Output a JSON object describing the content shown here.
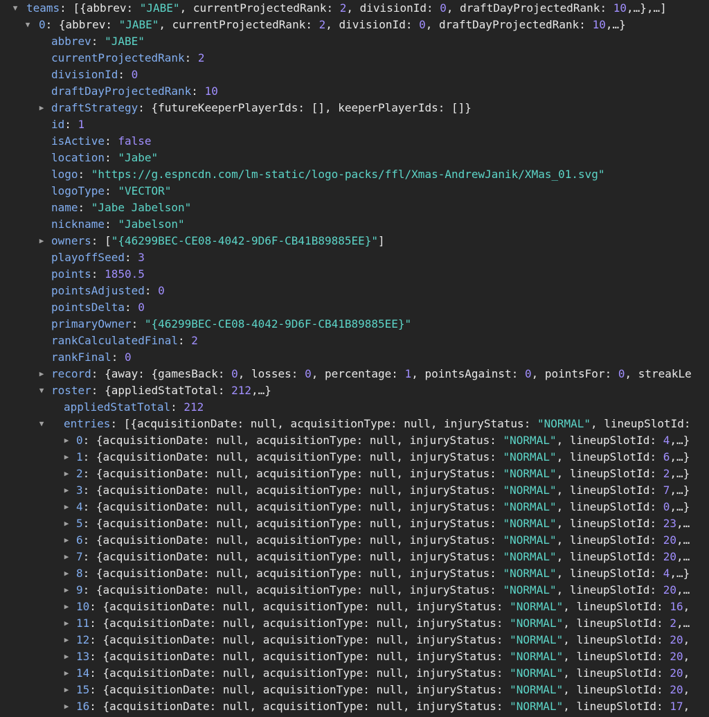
{
  "colors": {
    "background": "#242424",
    "key": "#82aef0",
    "string": "#5cd5c8",
    "number": "#a18fff",
    "text": "#e8e8e8",
    "toggle": "#a0a0a0"
  },
  "icons": {
    "expanded": "triangle-down-icon",
    "collapsed": "triangle-right-icon"
  },
  "rows": [
    {
      "depth": 0,
      "toggle": "expanded",
      "key": "teams",
      "summary": "[{abbrev: \"JABE\", currentProjectedRank: 2, divisionId: 0, draftDayProjectedRank: 10,…},…]"
    },
    {
      "depth": 1,
      "toggle": "expanded",
      "key": "0",
      "summary": "{abbrev: \"JABE\", currentProjectedRank: 2, divisionId: 0, draftDayProjectedRank: 10,…}"
    },
    {
      "depth": 2,
      "key": "abbrev",
      "value": "\"JABE\"",
      "type": "string"
    },
    {
      "depth": 2,
      "key": "currentProjectedRank",
      "value": "2",
      "type": "number"
    },
    {
      "depth": 2,
      "key": "divisionId",
      "value": "0",
      "type": "number"
    },
    {
      "depth": 2,
      "key": "draftDayProjectedRank",
      "value": "10",
      "type": "number"
    },
    {
      "depth": 2,
      "toggle": "collapsed",
      "key": "draftStrategy",
      "summary": "{futureKeeperPlayerIds: [], keeperPlayerIds: []}"
    },
    {
      "depth": 2,
      "key": "id",
      "value": "1",
      "type": "number"
    },
    {
      "depth": 2,
      "key": "isActive",
      "value": "false",
      "type": "keyword"
    },
    {
      "depth": 2,
      "key": "location",
      "value": "\"Jabe\"",
      "type": "string"
    },
    {
      "depth": 2,
      "key": "logo",
      "value": "\"https://g.espncdn.com/lm-static/logo-packs/ffl/Xmas-AndrewJanik/XMas_01.svg\"",
      "type": "string"
    },
    {
      "depth": 2,
      "key": "logoType",
      "value": "\"VECTOR\"",
      "type": "string"
    },
    {
      "depth": 2,
      "key": "name",
      "value": "\"Jabe Jabelson\"",
      "type": "string"
    },
    {
      "depth": 2,
      "key": "nickname",
      "value": "\"Jabelson\"",
      "type": "string"
    },
    {
      "depth": 2,
      "toggle": "collapsed",
      "key": "owners",
      "summary": "[\"{46299BEC-CE08-4042-9D6F-CB41B89885EE}\"]"
    },
    {
      "depth": 2,
      "key": "playoffSeed",
      "value": "3",
      "type": "number"
    },
    {
      "depth": 2,
      "key": "points",
      "value": "1850.5",
      "type": "number"
    },
    {
      "depth": 2,
      "key": "pointsAdjusted",
      "value": "0",
      "type": "number"
    },
    {
      "depth": 2,
      "key": "pointsDelta",
      "value": "0",
      "type": "number"
    },
    {
      "depth": 2,
      "key": "primaryOwner",
      "value": "\"{46299BEC-CE08-4042-9D6F-CB41B89885EE}\"",
      "type": "string"
    },
    {
      "depth": 2,
      "key": "rankCalculatedFinal",
      "value": "2",
      "type": "number"
    },
    {
      "depth": 2,
      "key": "rankFinal",
      "value": "0",
      "type": "number"
    },
    {
      "depth": 2,
      "toggle": "collapsed",
      "key": "record",
      "summary": "{away: {gamesBack: 0, losses: 0, percentage: 1, pointsAgainst: 0, pointsFor: 0, streakLe"
    },
    {
      "depth": 2,
      "toggle": "expanded",
      "key": "roster",
      "summary": "{appliedStatTotal: 212,…}"
    },
    {
      "depth": 3,
      "key": "appliedStatTotal",
      "value": "212",
      "type": "number"
    },
    {
      "depth": 3,
      "toggle": "expanded",
      "key": "entries",
      "summary": "[{acquisitionDate: null, acquisitionType: null, injuryStatus: \"NORMAL\", lineupSlotId:"
    },
    {
      "depth": 4,
      "toggle": "collapsed",
      "key": "0",
      "summary": "{acquisitionDate: null, acquisitionType: null, injuryStatus: \"NORMAL\", lineupSlotId: 4,…}"
    },
    {
      "depth": 4,
      "toggle": "collapsed",
      "key": "1",
      "summary": "{acquisitionDate: null, acquisitionType: null, injuryStatus: \"NORMAL\", lineupSlotId: 6,…}"
    },
    {
      "depth": 4,
      "toggle": "collapsed",
      "key": "2",
      "summary": "{acquisitionDate: null, acquisitionType: null, injuryStatus: \"NORMAL\", lineupSlotId: 2,…}"
    },
    {
      "depth": 4,
      "toggle": "collapsed",
      "key": "3",
      "summary": "{acquisitionDate: null, acquisitionType: null, injuryStatus: \"NORMAL\", lineupSlotId: 7,…}"
    },
    {
      "depth": 4,
      "toggle": "collapsed",
      "key": "4",
      "summary": "{acquisitionDate: null, acquisitionType: null, injuryStatus: \"NORMAL\", lineupSlotId: 0,…}"
    },
    {
      "depth": 4,
      "toggle": "collapsed",
      "key": "5",
      "summary": "{acquisitionDate: null, acquisitionType: null, injuryStatus: \"NORMAL\", lineupSlotId: 23,…"
    },
    {
      "depth": 4,
      "toggle": "collapsed",
      "key": "6",
      "summary": "{acquisitionDate: null, acquisitionType: null, injuryStatus: \"NORMAL\", lineupSlotId: 20,…"
    },
    {
      "depth": 4,
      "toggle": "collapsed",
      "key": "7",
      "summary": "{acquisitionDate: null, acquisitionType: null, injuryStatus: \"NORMAL\", lineupSlotId: 20,…"
    },
    {
      "depth": 4,
      "toggle": "collapsed",
      "key": "8",
      "summary": "{acquisitionDate: null, acquisitionType: null, injuryStatus: \"NORMAL\", lineupSlotId: 4,…}"
    },
    {
      "depth": 4,
      "toggle": "collapsed",
      "key": "9",
      "summary": "{acquisitionDate: null, acquisitionType: null, injuryStatus: \"NORMAL\", lineupSlotId: 20,…"
    },
    {
      "depth": 4,
      "toggle": "collapsed",
      "key": "10",
      "summary": "{acquisitionDate: null, acquisitionType: null, injuryStatus: \"NORMAL\", lineupSlotId: 16,"
    },
    {
      "depth": 4,
      "toggle": "collapsed",
      "key": "11",
      "summary": "{acquisitionDate: null, acquisitionType: null, injuryStatus: \"NORMAL\", lineupSlotId: 2,…"
    },
    {
      "depth": 4,
      "toggle": "collapsed",
      "key": "12",
      "summary": "{acquisitionDate: null, acquisitionType: null, injuryStatus: \"NORMAL\", lineupSlotId: 20,"
    },
    {
      "depth": 4,
      "toggle": "collapsed",
      "key": "13",
      "summary": "{acquisitionDate: null, acquisitionType: null, injuryStatus: \"NORMAL\", lineupSlotId: 20,"
    },
    {
      "depth": 4,
      "toggle": "collapsed",
      "key": "14",
      "summary": "{acquisitionDate: null, acquisitionType: null, injuryStatus: \"NORMAL\", lineupSlotId: 20,"
    },
    {
      "depth": 4,
      "toggle": "collapsed",
      "key": "15",
      "summary": "{acquisitionDate: null, acquisitionType: null, injuryStatus: \"NORMAL\", lineupSlotId: 20,"
    },
    {
      "depth": 4,
      "toggle": "collapsed",
      "key": "16",
      "summary": "{acquisitionDate: null, acquisitionType: null, injuryStatus: \"NORMAL\", lineupSlotId: 17,"
    }
  ]
}
